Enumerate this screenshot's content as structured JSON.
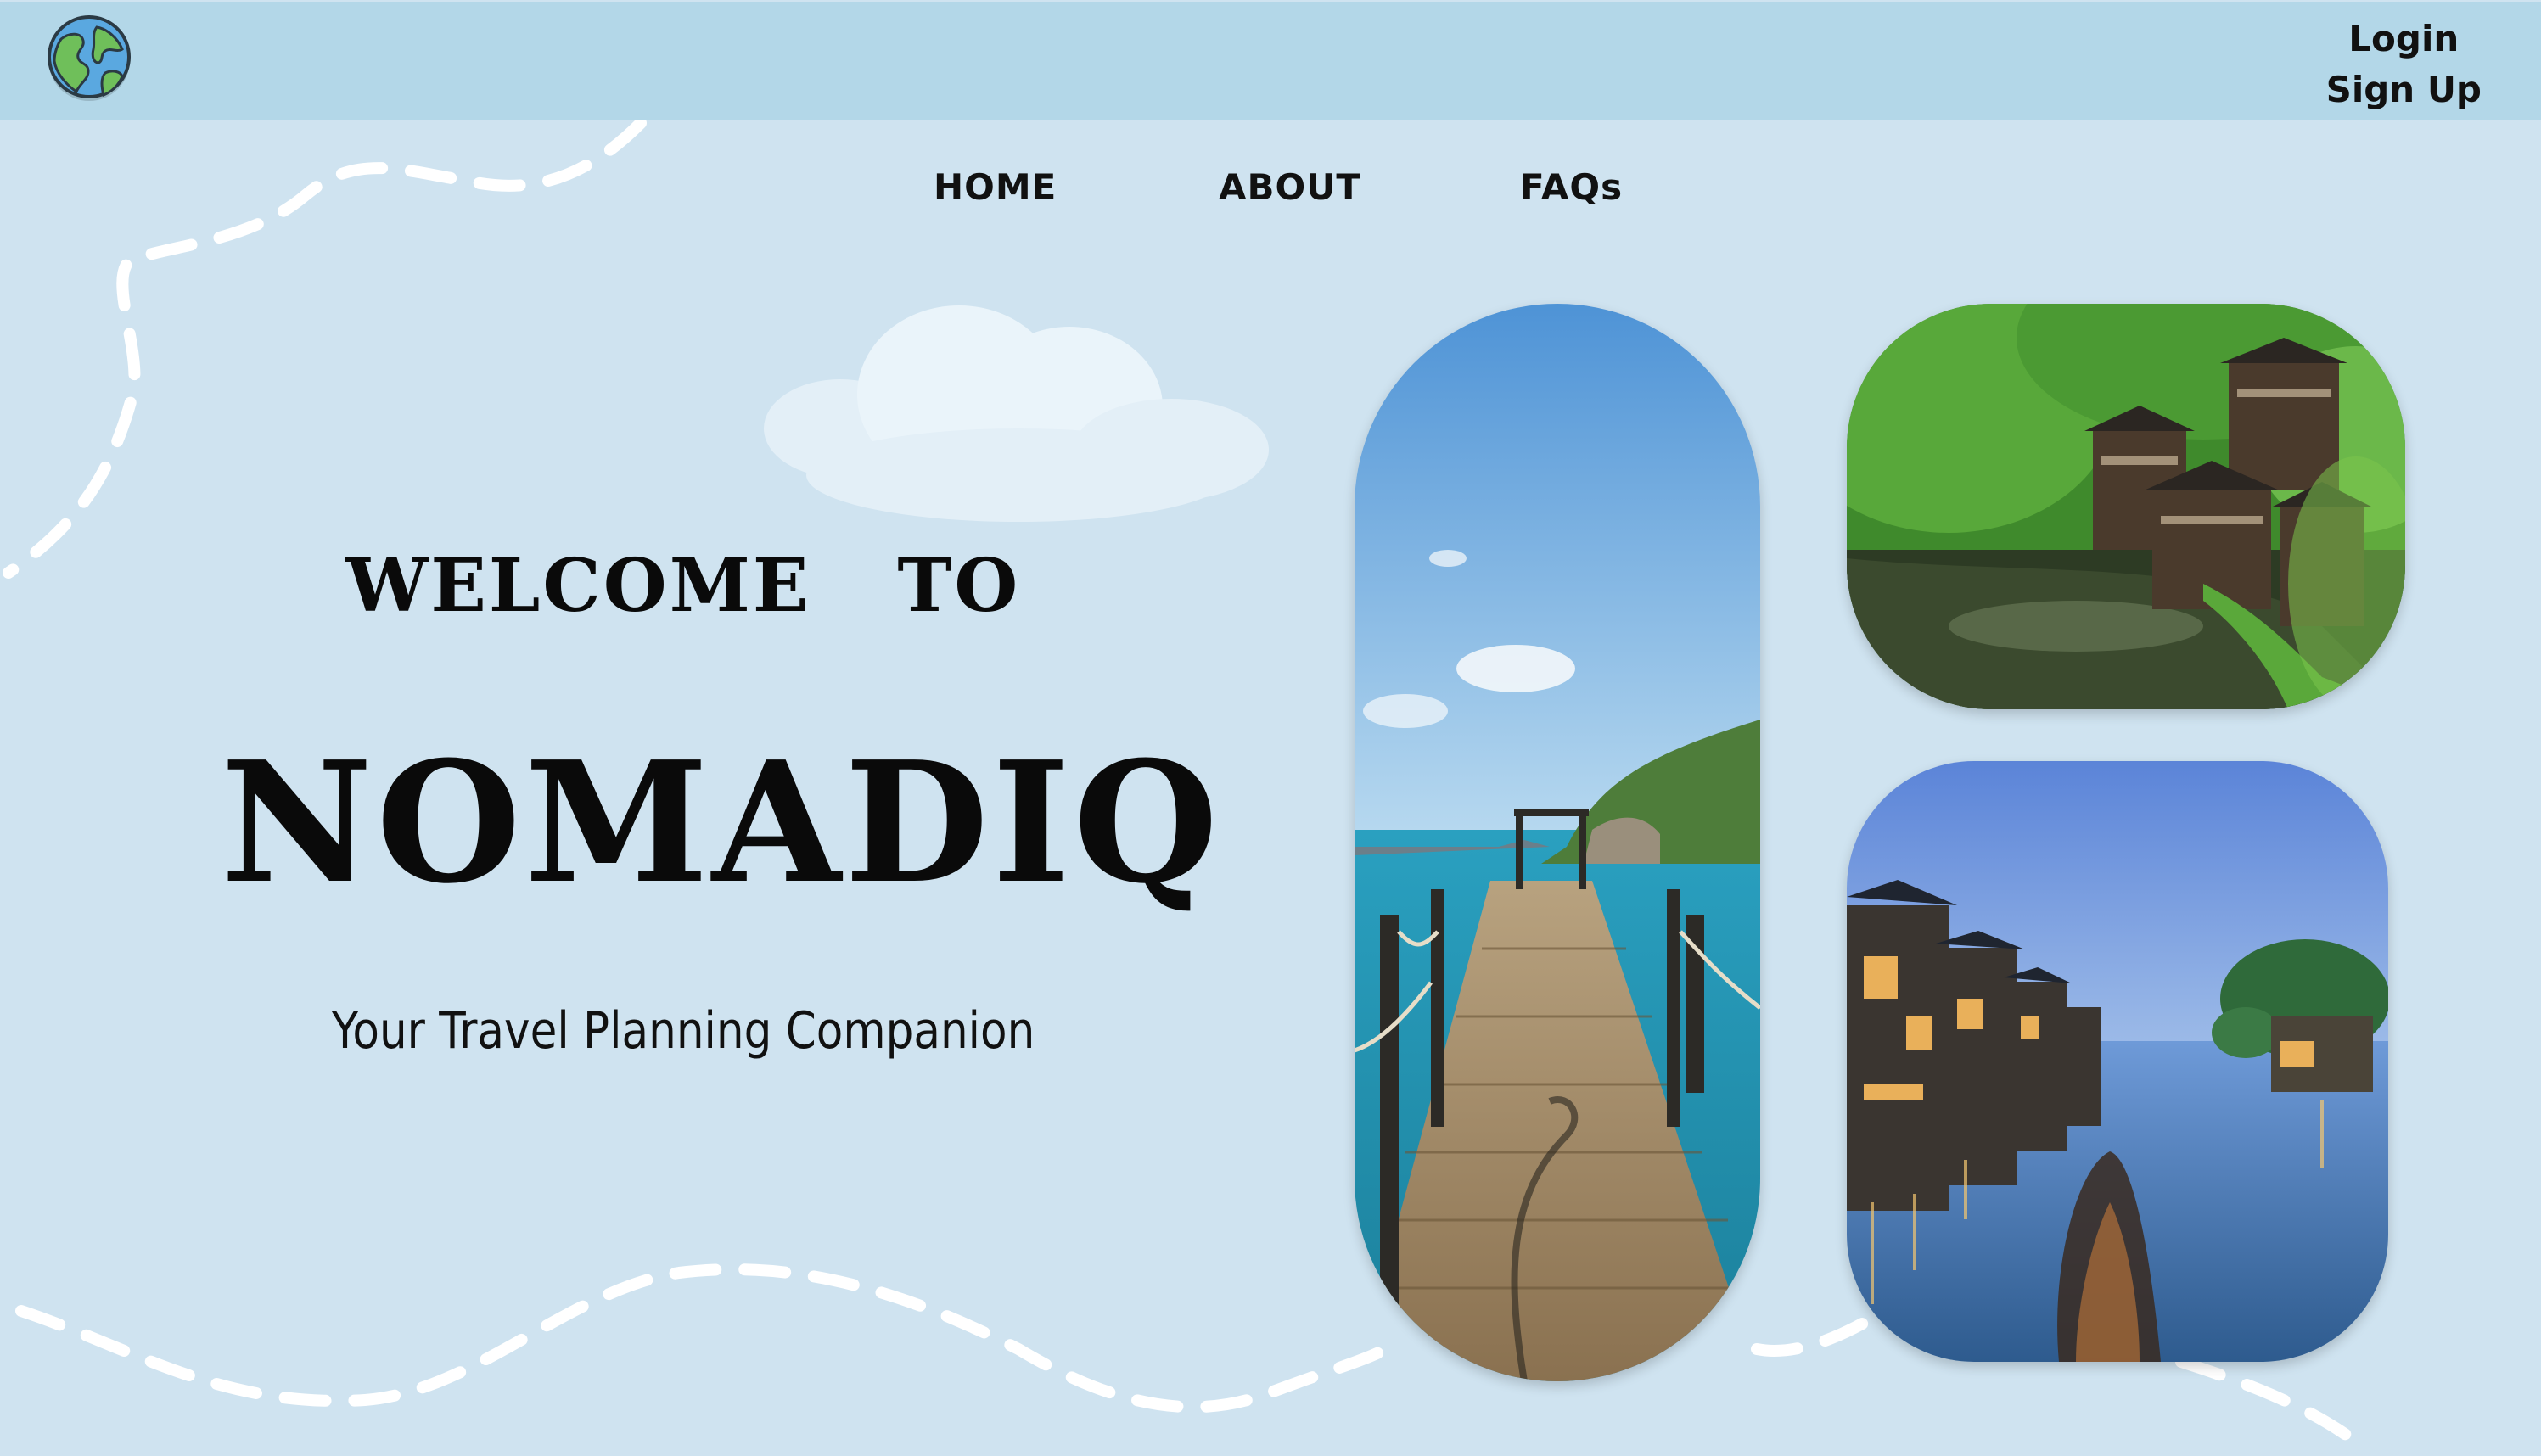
{
  "header": {
    "logo_icon": "globe-icon",
    "login_label": "Login",
    "signup_label": "Sign Up"
  },
  "nav": {
    "items": [
      {
        "label": "HOME"
      },
      {
        "label": "ABOUT"
      },
      {
        "label": "FAQs"
      }
    ]
  },
  "hero": {
    "welcome": "WELCOME  TO",
    "brand": "NOMADIQ",
    "tagline": "Your Travel Planning Companion"
  },
  "photos": [
    {
      "subject": "wooden-pier-over-turquoise-sea"
    },
    {
      "subject": "wooden-houses-by-green-lake"
    },
    {
      "subject": "canal-town-at-dusk"
    }
  ],
  "colors": {
    "page_bg": "#cfe3f0",
    "header_bg": "#b3d7e8",
    "text": "#111111",
    "dash_path": "#ffffff"
  }
}
